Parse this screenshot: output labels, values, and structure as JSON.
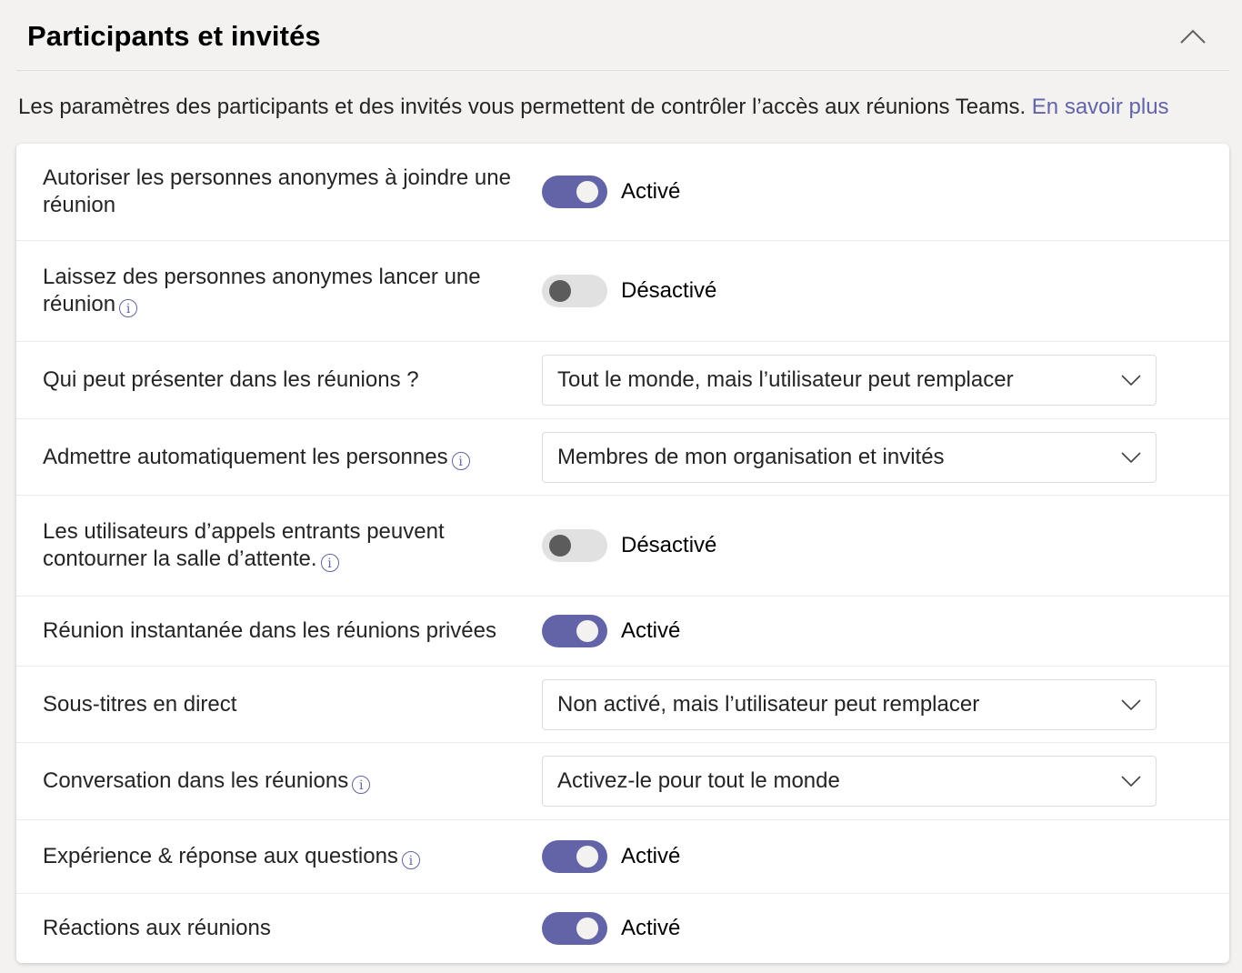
{
  "header": {
    "title": "Participants et invités",
    "collapse_icon": "chevron-up-icon"
  },
  "description": {
    "text": "Les paramètres des participants et des invités vous permettent de contrôler l’accès aux réunions Teams. ",
    "link": "En savoir plus"
  },
  "colors": {
    "accent": "#6264a7",
    "toggle_off": "#e1e1e1",
    "knob_off": "#5c5c5c"
  },
  "settings": [
    {
      "label": "Autoriser les personnes anonymes à joindre une réunion",
      "info": false,
      "type": "toggle",
      "on": true,
      "value": "Activé"
    },
    {
      "label": "Laissez des personnes anonymes lancer une réunion",
      "info": true,
      "type": "toggle",
      "on": false,
      "value": "Désactivé"
    },
    {
      "label": "Qui peut présenter dans les réunions ?",
      "info": false,
      "type": "select",
      "value": "Tout le monde, mais l’utilisateur peut remplacer"
    },
    {
      "label": "Admettre automatiquement les personnes",
      "info": true,
      "type": "select",
      "value": "Membres de mon organisation et invités"
    },
    {
      "label": "Les utilisateurs d’appels entrants peuvent contourner la salle d’attente.",
      "info": true,
      "type": "toggle",
      "on": false,
      "value": "Désactivé"
    },
    {
      "label": "Réunion instantanée dans les réunions privées",
      "info": false,
      "type": "toggle",
      "on": true,
      "value": "Activé"
    },
    {
      "label": "Sous-titres en direct",
      "info": false,
      "type": "select",
      "value": "Non activé, mais l’utilisateur peut remplacer"
    },
    {
      "label": "Conversation dans les réunions",
      "info": true,
      "type": "select",
      "value": "Activez-le pour tout le monde"
    },
    {
      "label": "Expérience & réponse aux questions",
      "info": true,
      "type": "toggle",
      "on": true,
      "value": "Activé"
    },
    {
      "label": "Réactions aux réunions",
      "info": false,
      "type": "toggle",
      "on": true,
      "value": "Activé"
    }
  ]
}
